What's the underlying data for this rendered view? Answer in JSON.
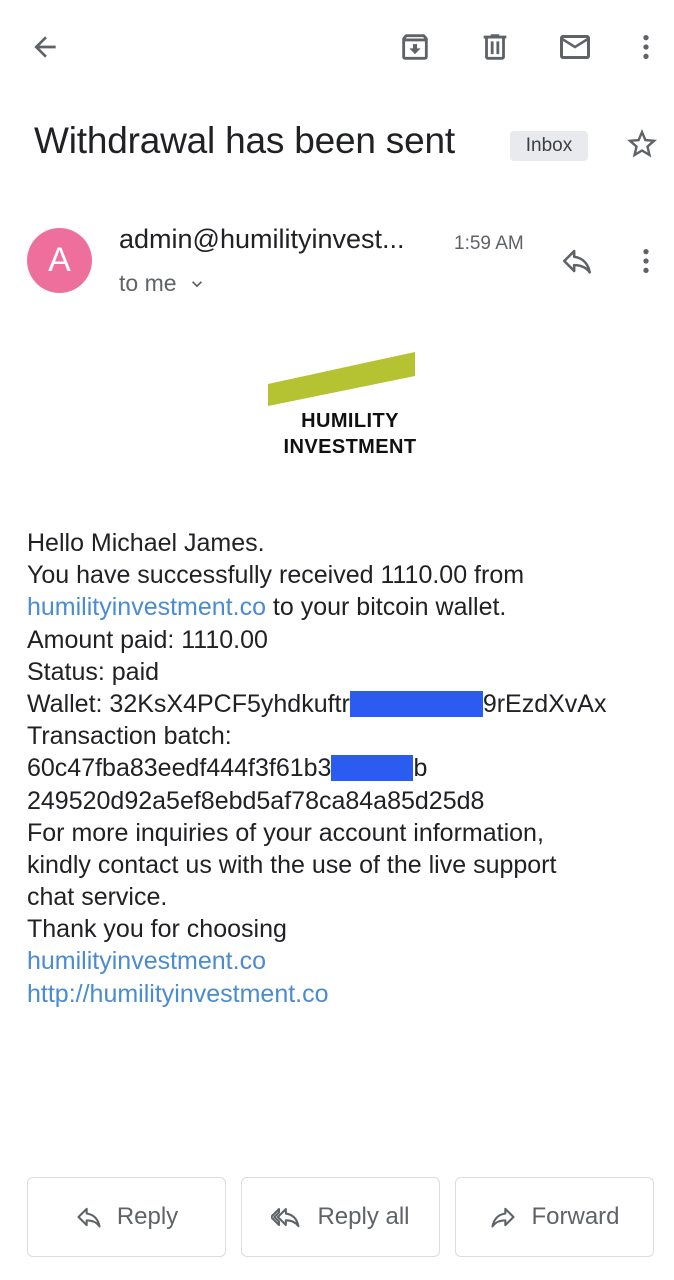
{
  "toolbar": {
    "back_icon": "arrow-back-icon",
    "archive_icon": "archive-icon",
    "delete_icon": "trash-icon",
    "mark_unread_icon": "mail-icon",
    "more_icon": "more-vert-icon"
  },
  "email": {
    "subject": "Withdrawal has been sent",
    "label": "Inbox",
    "starred": false,
    "sender": {
      "initial": "A",
      "avatar_color": "#ee6f9b",
      "address": "admin@humilityinvest...",
      "time": "1:59 AM",
      "recipient": "to me"
    },
    "logo": {
      "line1": "HUMILITY",
      "line2": "INVESTMENT",
      "accent_color": "#b5c232"
    },
    "body": {
      "greeting": "Hello Michael James.",
      "received_prefix": "You have successfully received 1110.00 from",
      "site_link": "humilityinvestment.co",
      "received_suffix": " to your bitcoin wallet.",
      "amount": "Amount paid:  1110.00",
      "status": "Status: paid",
      "wallet_start": "Wallet: 32KsX4PCF5yhdkuftr",
      "wallet_end": "9rEzdXvAx",
      "batch_label": "Transaction batch:",
      "batch_line1_start": "60c47fba83eedf444f3f61b3",
      "batch_line1_end": "b",
      "batch_line2": "249520d92a5ef8ebd5af78ca84a85d25d8",
      "inquiry_line1": "For more inquiries of your account information,",
      "inquiry_line2": "kindly contact us with the use of the live support",
      "inquiry_line3": "chat service.",
      "thanks": "Thank you for choosing",
      "footer_link1": "humilityinvestment.co",
      "footer_link2": "http://humilityinvestment.co"
    }
  },
  "actions": {
    "reply": "Reply",
    "reply_all": "Reply all",
    "forward": "Forward"
  },
  "colors": {
    "link": "#4a8bd2",
    "redaction": "#2a5cf0",
    "badge_bg": "#e8eaed"
  }
}
